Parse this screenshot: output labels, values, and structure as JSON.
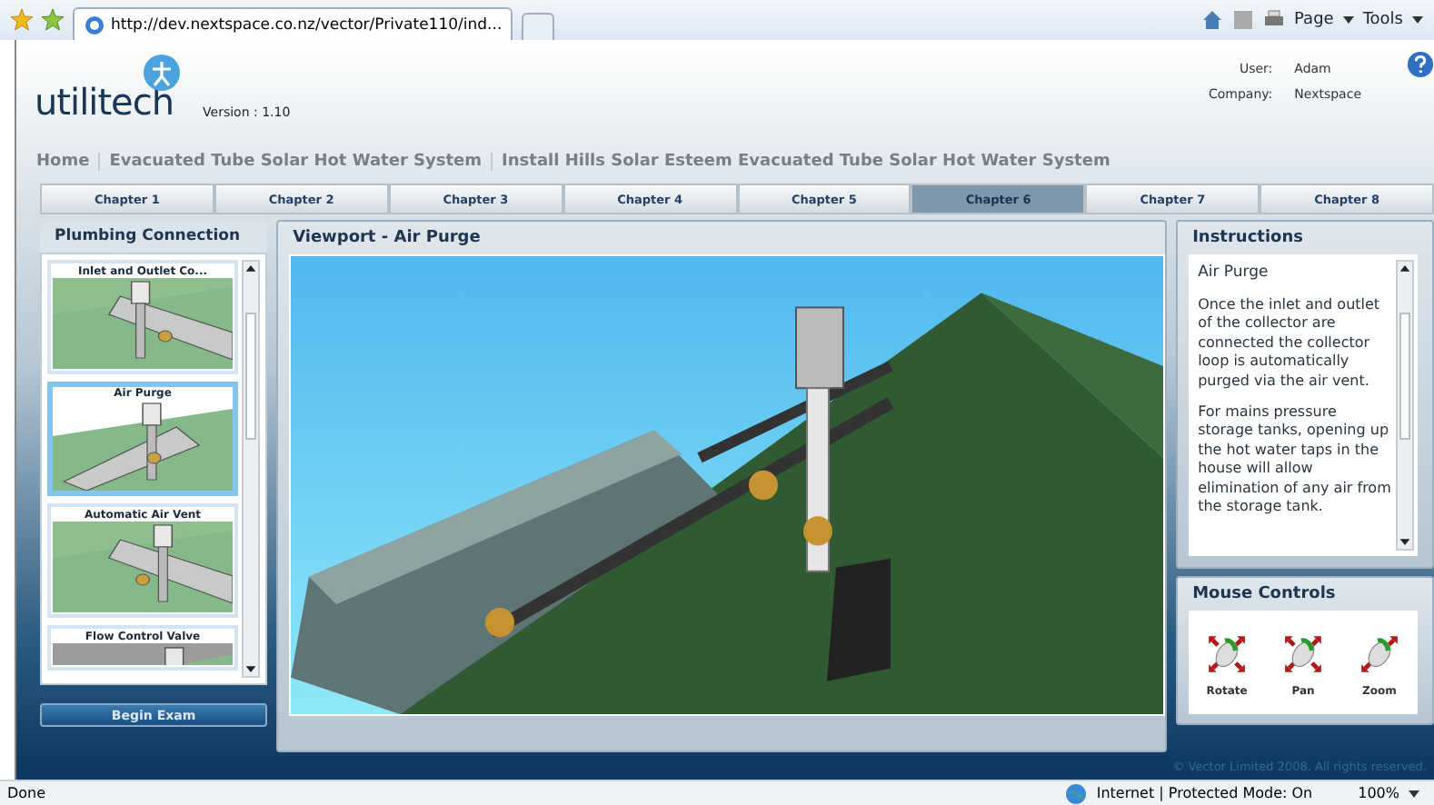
{
  "browser": {
    "tab_title": "http://dev.nextspace.co.nz/vector/Private110/ind...",
    "toolbar": [
      "Page",
      "Tools"
    ]
  },
  "header": {
    "logo": "utilitech",
    "version": "Version : 1.10",
    "user_label": "User:",
    "user": "Adam",
    "company_label": "Company:",
    "company": "Nextspace"
  },
  "breadcrumbs": [
    "Home",
    "Evacuated Tube Solar Hot Water System",
    "Install Hills Solar Esteem Evacuated Tube Solar Hot Water System"
  ],
  "chapters": [
    {
      "label": "Chapter 1",
      "selected": false
    },
    {
      "label": "Chapter 2",
      "selected": false
    },
    {
      "label": "Chapter 3",
      "selected": false
    },
    {
      "label": "Chapter 4",
      "selected": false
    },
    {
      "label": "Chapter 5",
      "selected": false
    },
    {
      "label": "Chapter 6",
      "selected": true
    },
    {
      "label": "Chapter 7",
      "selected": false
    },
    {
      "label": "Chapter 8",
      "selected": false
    }
  ],
  "steps_panel": {
    "title": "Plumbing Connection",
    "items": [
      {
        "caption": "Inlet and Outlet Co...",
        "selected": false
      },
      {
        "caption": "Air Purge",
        "selected": true
      },
      {
        "caption": "Automatic Air Vent",
        "selected": false
      },
      {
        "caption": "Flow Control Valve",
        "selected": false
      }
    ],
    "button": "Begin Exam"
  },
  "viewport": {
    "title": "Viewport -  Air Purge"
  },
  "instructions": {
    "title": "Instructions",
    "heading": "Air Purge",
    "paragraphs": [
      "Once the inlet and outlet of the collector are connected the collector loop is automatically purged via the air vent.",
      "For mains pressure storage tanks, opening up the hot water taps in the house will allow elimination of any air from the storage tank."
    ]
  },
  "mouse_controls": {
    "title": "Mouse Controls",
    "items": [
      {
        "label": "Rotate",
        "kind": "rotate"
      },
      {
        "label": "Pan",
        "kind": "pan"
      },
      {
        "label": "Zoom",
        "kind": "zoom"
      }
    ]
  },
  "footer": "© Vector Limited 2008. All rights reserved.",
  "status_bar": {
    "status": "Done",
    "zone": "Internet | Protected Mode: On",
    "zoom": "100%"
  }
}
